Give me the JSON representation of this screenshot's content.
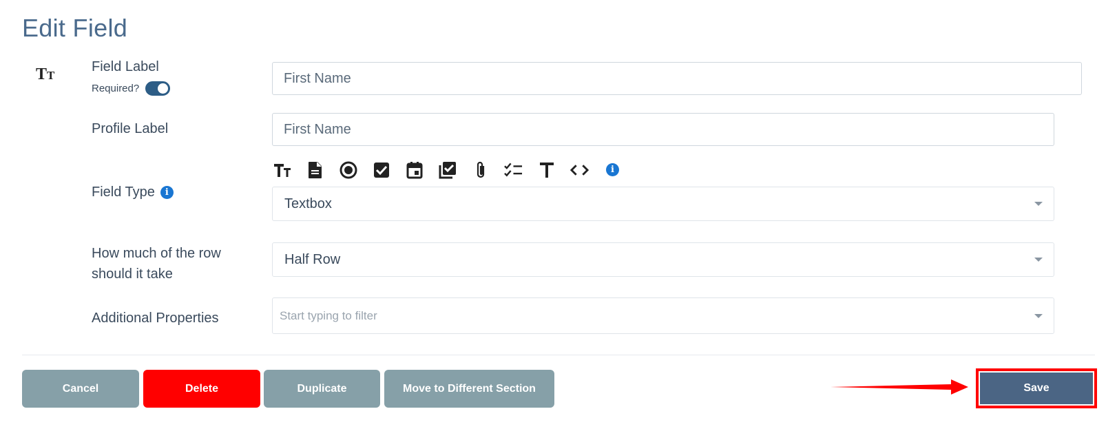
{
  "page_title": "Edit Field",
  "field_label": {
    "label": "Field Label",
    "required_label": "Required?",
    "required_on": true,
    "value": "First Name"
  },
  "profile_label": {
    "label": "Profile Label",
    "value": "First Name"
  },
  "field_type": {
    "label": "Field Type",
    "info_glyph": "i",
    "selected": "Textbox",
    "type_icons": [
      "textbox-icon",
      "document-icon",
      "radio-icon",
      "checkbox-icon",
      "calendar-icon",
      "multi-checkbox-icon",
      "attachment-icon",
      "checklist-icon",
      "text-icon",
      "code-icon",
      "info-icon"
    ]
  },
  "row_width": {
    "label": "How much of the row should it take",
    "selected": "Half Row"
  },
  "additional_properties": {
    "label": "Additional Properties",
    "placeholder": "Start typing to filter"
  },
  "buttons": {
    "cancel": "Cancel",
    "delete": "Delete",
    "duplicate": "Duplicate",
    "move": "Move to Different Section",
    "save": "Save"
  },
  "colors": {
    "accent": "#4b6584",
    "danger": "#ff0000",
    "muted_button": "#86a0a8",
    "info": "#1976d2",
    "highlight": "#ff0000"
  }
}
